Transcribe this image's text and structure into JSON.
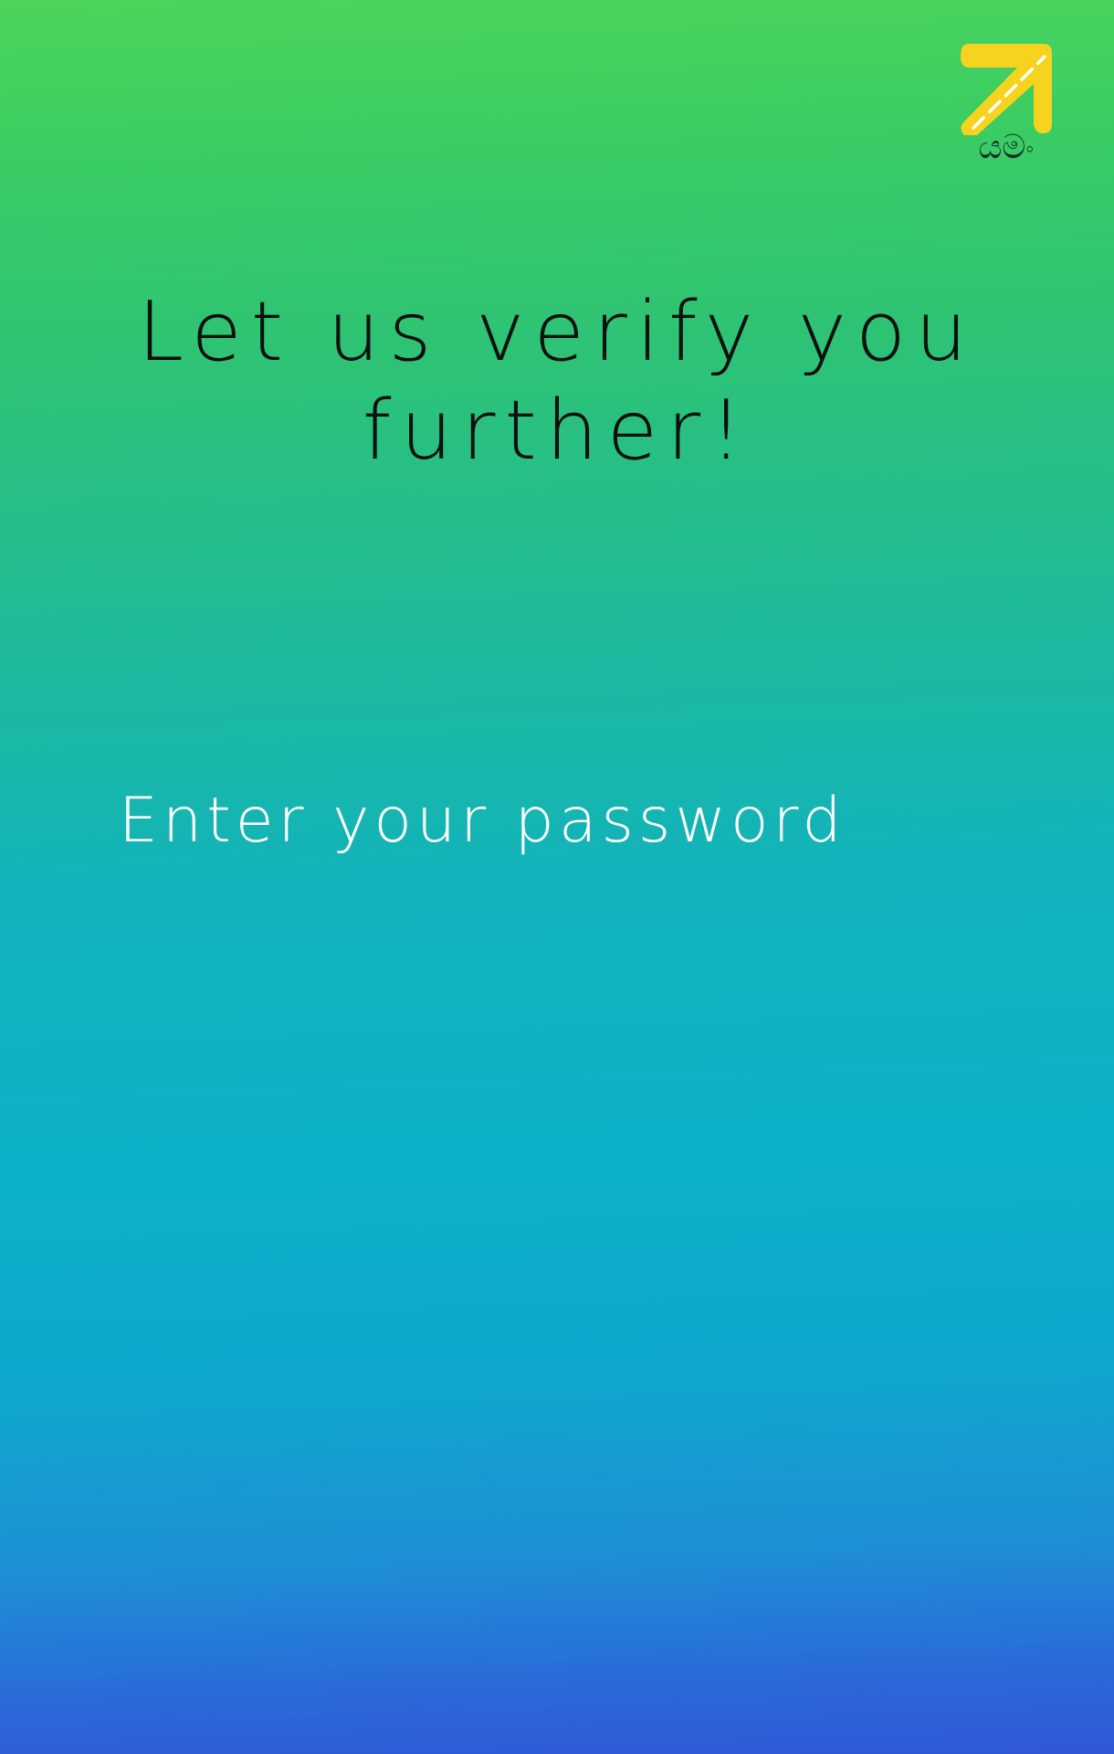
{
  "app": {
    "logo_text": "යමං",
    "logo_icon": "arrow-up-right-road-icon",
    "logo_color": "#f6d31e"
  },
  "verify": {
    "headline": "Let us verify you further!",
    "password_placeholder": "Enter your password",
    "password_value": ""
  },
  "colors": {
    "gradient_top": "#4cd45a",
    "gradient_middle": "#0cb0c8",
    "gradient_bottom": "#3157d8",
    "headline_text": "#0b0f0e",
    "placeholder_text": "#ffffff"
  }
}
